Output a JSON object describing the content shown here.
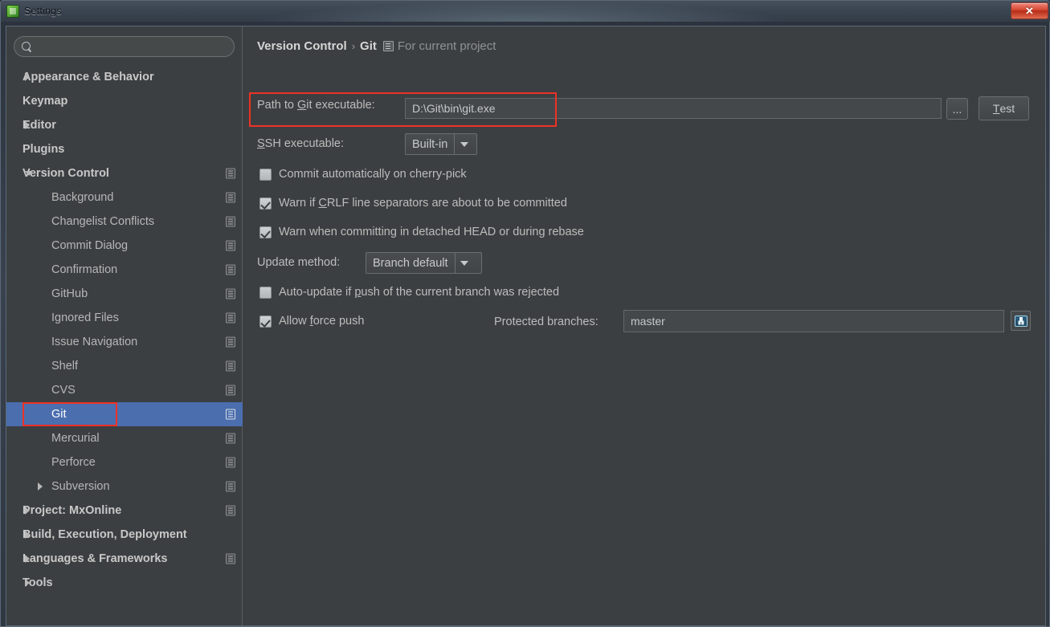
{
  "window": {
    "title": "Settings",
    "app_icon": "settings-app-icon",
    "close_label": "✕"
  },
  "sidebar": {
    "search": {
      "value": "",
      "placeholder": "",
      "icon": "search-icon"
    },
    "items": [
      {
        "label": "Appearance & Behavior",
        "level": 0,
        "arrow": "collapsed",
        "scope_icon": false,
        "selected": false
      },
      {
        "label": "Keymap",
        "level": 0,
        "arrow": "none",
        "scope_icon": false,
        "selected": false
      },
      {
        "label": "Editor",
        "level": 0,
        "arrow": "collapsed",
        "scope_icon": false,
        "selected": false
      },
      {
        "label": "Plugins",
        "level": 0,
        "arrow": "none",
        "scope_icon": false,
        "selected": false
      },
      {
        "label": "Version Control",
        "level": 0,
        "arrow": "expanded",
        "scope_icon": true,
        "selected": false
      },
      {
        "label": "Background",
        "level": 1,
        "arrow": "none",
        "scope_icon": true,
        "selected": false
      },
      {
        "label": "Changelist Conflicts",
        "level": 1,
        "arrow": "none",
        "scope_icon": true,
        "selected": false
      },
      {
        "label": "Commit Dialog",
        "level": 1,
        "arrow": "none",
        "scope_icon": true,
        "selected": false
      },
      {
        "label": "Confirmation",
        "level": 1,
        "arrow": "none",
        "scope_icon": true,
        "selected": false
      },
      {
        "label": "GitHub",
        "level": 1,
        "arrow": "none",
        "scope_icon": true,
        "selected": false
      },
      {
        "label": "Ignored Files",
        "level": 1,
        "arrow": "none",
        "scope_icon": true,
        "selected": false
      },
      {
        "label": "Issue Navigation",
        "level": 1,
        "arrow": "none",
        "scope_icon": true,
        "selected": false
      },
      {
        "label": "Shelf",
        "level": 1,
        "arrow": "none",
        "scope_icon": true,
        "selected": false
      },
      {
        "label": "CVS",
        "level": 1,
        "arrow": "none",
        "scope_icon": true,
        "selected": false
      },
      {
        "label": "Git",
        "level": 1,
        "arrow": "none",
        "scope_icon": true,
        "selected": true
      },
      {
        "label": "Mercurial",
        "level": 1,
        "arrow": "none",
        "scope_icon": true,
        "selected": false
      },
      {
        "label": "Perforce",
        "level": 1,
        "arrow": "none",
        "scope_icon": true,
        "selected": false
      },
      {
        "label": "Subversion",
        "level": 1,
        "arrow": "collapsed",
        "scope_icon": true,
        "selected": false
      },
      {
        "label": "Project: MxOnline",
        "level": 0,
        "arrow": "collapsed",
        "scope_icon": true,
        "selected": false
      },
      {
        "label": "Build, Execution, Deployment",
        "level": 0,
        "arrow": "collapsed",
        "scope_icon": false,
        "selected": false
      },
      {
        "label": "Languages & Frameworks",
        "level": 0,
        "arrow": "collapsed",
        "scope_icon": true,
        "selected": false
      },
      {
        "label": "Tools",
        "level": 0,
        "arrow": "collapsed",
        "scope_icon": false,
        "selected": false
      }
    ]
  },
  "breadcrumb": {
    "root": "Version Control",
    "separator": "›",
    "current": "Git",
    "scope_icon": "project-scope-icon",
    "scope_text": "For current project"
  },
  "form": {
    "git_path": {
      "label_pre": "Path to ",
      "label_mnemonic": "G",
      "label_post": "it executable:",
      "value": "D:\\Git\\bin\\git.exe",
      "browse_label": "...",
      "test_label_mnemonic": "T",
      "test_label_rest": "est"
    },
    "ssh": {
      "label_mnemonic": "S",
      "label_rest": "SH executable:",
      "value": "Built-in"
    },
    "checkbox_cherry_pick": {
      "label": "Commit automatically on cherry-pick",
      "checked": false
    },
    "checkbox_crlf": {
      "label_pre": "Warn if ",
      "label_mnemonic": "C",
      "label_post": "RLF line separators are about to be committed",
      "checked": true
    },
    "checkbox_detached": {
      "label": "Warn when committing in detached HEAD or during rebase",
      "checked": true
    },
    "update_method": {
      "label": "Update method:",
      "value": "Branch default"
    },
    "checkbox_autoupdate": {
      "label_pre": "Auto-update if ",
      "label_mnemonic": "p",
      "label_post": "ush of the current branch was rejected",
      "checked": false
    },
    "checkbox_force_push": {
      "label_pre": "Allow ",
      "label_mnemonic": "f",
      "label_post": "orce push",
      "checked": true
    },
    "protected_branches": {
      "label": "Protected branches:",
      "value": "master",
      "button_icon": "save-import-icon"
    }
  },
  "annotations": {
    "highlight_color": "#ee3124",
    "selection_color": "#4b6eaf"
  }
}
